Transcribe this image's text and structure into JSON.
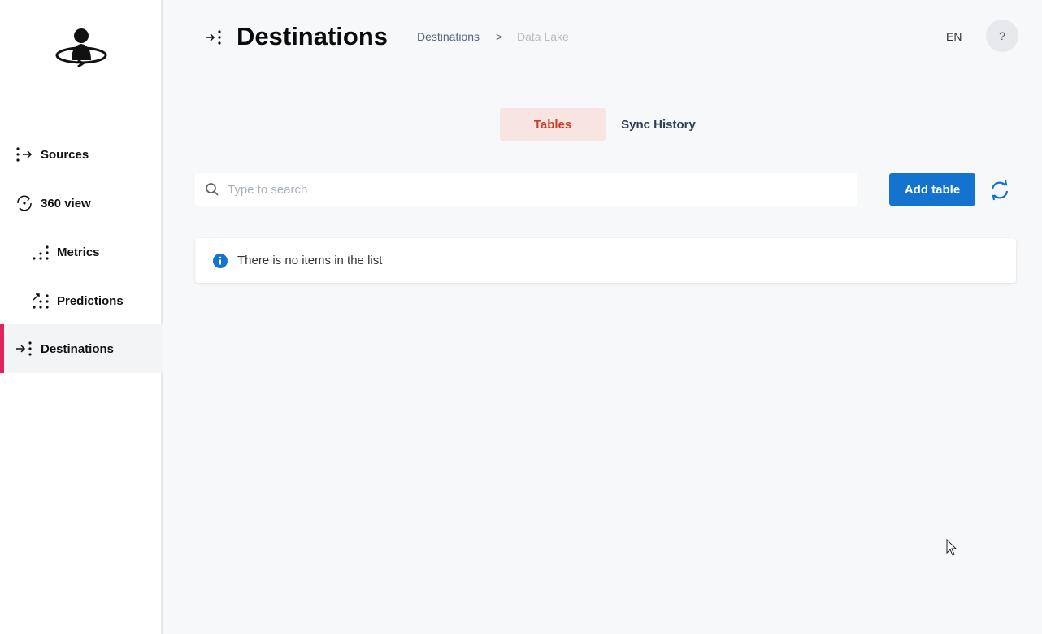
{
  "app": {
    "brand_color": "#e0245e",
    "accent": "#1473cf"
  },
  "sidebar": {
    "logo": "user-orbit-logo",
    "items": [
      {
        "label": "Sources",
        "icon": "dots-arrow-right-icon"
      },
      {
        "label": "360 view",
        "icon": "rotate-360-icon"
      },
      {
        "label": "Metrics",
        "icon": "dots-metrics-icon"
      },
      {
        "label": "Predictions",
        "icon": "dots-trend-arrow-icon"
      },
      {
        "label": "Destinations",
        "icon": "arrow-dots-icon",
        "active": true
      }
    ]
  },
  "header": {
    "title": "Destinations",
    "icon": "arrow-dots-icon",
    "breadcrumb": [
      "Destinations",
      ">",
      "Data Lake"
    ],
    "language": "EN",
    "help_label": "?"
  },
  "tabs": [
    {
      "label": "Tables",
      "active": true
    },
    {
      "label": "Sync History",
      "active": false
    }
  ],
  "toolbar": {
    "search_placeholder": "Type to search",
    "search_value": "",
    "add_label": "Add table",
    "refresh_icon": "refresh-icon"
  },
  "list": {
    "empty_message": "There is no items in the list",
    "info_icon": "info-icon"
  }
}
